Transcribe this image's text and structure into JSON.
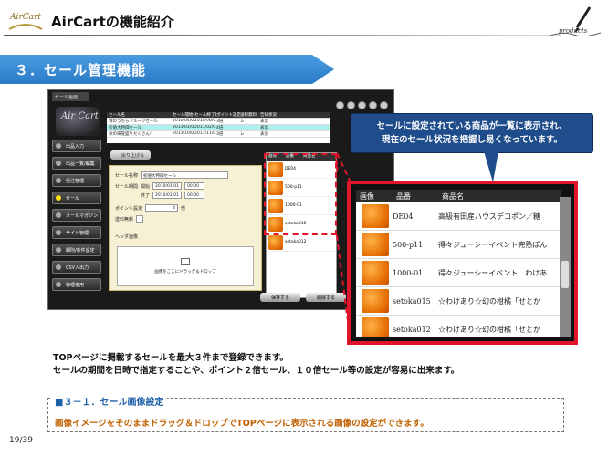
{
  "header": {
    "logo_text": "AirCart",
    "title": "AirCartの機能紹介",
    "pen_caption": "products"
  },
  "section": {
    "title": "３．セール管理機能"
  },
  "app": {
    "tab_label": "セール画面",
    "logo_text": "Air Cart",
    "sidebar": [
      {
        "label": "出品入力",
        "active": false
      },
      {
        "label": "出品一覧/編集",
        "active": false
      },
      {
        "label": "受注管理",
        "active": false
      },
      {
        "label": "セール",
        "active": true
      },
      {
        "label": "メールマガジン",
        "active": false
      },
      {
        "label": "サイト管理",
        "active": false
      },
      {
        "label": "細則/条件設定",
        "active": false
      },
      {
        "label": "CSV入出力",
        "active": false
      },
      {
        "label": "管理者用",
        "active": false
      }
    ],
    "list": {
      "headers": [
        "セール名",
        "セール開始日",
        "セール終了日",
        "ポイント設定",
        "送料無料",
        "告知状況"
      ],
      "rows": [
        {
          "cells": [
            "春のうちらフルーツセール",
            "2010/04/01",
            "2010/06/01",
            "3倍",
            "レ",
            "表示"
          ],
          "selected": false
        },
        {
          "cells": [
            "初値大特価セール",
            "2011/01/01",
            "2011/02/01",
            "4倍",
            "",
            "表示"
          ],
          "selected": true
        },
        {
          "cells": [
            "秋の味覚盛りだくさん!",
            "2011/10/01",
            "2011/11/01",
            "3倍",
            "レ",
            "表示"
          ],
          "selected": false
        }
      ]
    },
    "back_button": "戻り上げる",
    "form": {
      "name_label": "セール名称",
      "name_value": "初値大特価セール",
      "period_label": "セール期間",
      "start_label": "開始",
      "start_value": "2010/01/01",
      "start_time": "00:00",
      "end_label": "終了",
      "end_value": "2010/01/01",
      "end_time": "00:00",
      "point_label": "ポイント設定",
      "point_value": "4",
      "point_unit": "倍",
      "shipping_label": "送料無料",
      "header_image_label": "ヘッダ画像",
      "drop_text": "画像をここにドラッグ＆ドロップ"
    },
    "small_grid": {
      "headers": [
        "画像",
        "品番",
        "商品名"
      ],
      "rows": [
        {
          "code": "DE04",
          "name": "高級有田産ハウスデコポン／糖"
        },
        {
          "code": "500-p11",
          "name": "得々ジューシーイベント完熟ぽん"
        },
        {
          "code": "1000-01",
          "name": "得々ジューシーイベント わけあ"
        },
        {
          "code": "setoka015",
          "name": "☆わけあり☆幻の柑橘「せとか"
        },
        {
          "code": "setoka012",
          "name": "☆わけあり☆幻の柑橘「せとか"
        }
      ]
    },
    "save_button": "保存する",
    "delete_button": "削除する"
  },
  "zoom": {
    "headers": [
      "画像",
      "品番",
      "商品名"
    ],
    "rows": [
      {
        "code": "DE04",
        "name": "高級有田産ハウスデコポン／糖"
      },
      {
        "code": "500-p11",
        "name": "得々ジューシーイベント完熟ぽん"
      },
      {
        "code": "1000-01",
        "name": "得々ジューシーイベント　わけあ"
      },
      {
        "code": "setoka015",
        "name": "☆わけあり☆幻の柑橘「せとか"
      },
      {
        "code": "setoka012",
        "name": "☆わけあり☆幻の柑橘「せとか"
      }
    ]
  },
  "callout": {
    "line1": "セールに設定されている商品が一覧に表示され、",
    "line2": "現在のセール状況を把握し易くなっています。"
  },
  "description": {
    "line1": "TOPページに掲載するセールを最大３件まで登録できます。",
    "line2": "セールの期間を日時で指定することや、ポイント２倍セール、１０倍セール等の設定が容易に出来ます。"
  },
  "subsection": {
    "title": "■３－１．セール画像設定",
    "text": "画像イメージをそのままドラッグ＆ドロップでTOPページに表示される画像の設定ができます。"
  },
  "page": {
    "number": "19/39"
  },
  "colors": {
    "banner": "#2a7bc8",
    "highlight": "#e0142a",
    "callout": "#1f4d8c"
  }
}
